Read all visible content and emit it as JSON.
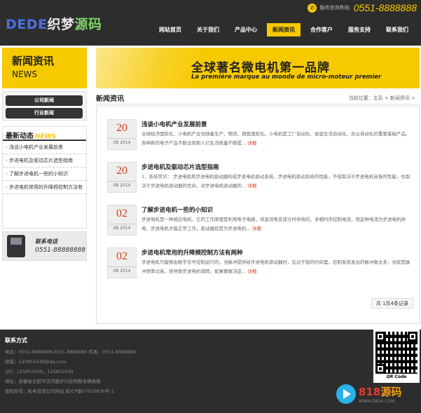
{
  "header": {
    "logo": {
      "part1": "DEDE",
      "part2": "织梦",
      "part3": "源码"
    },
    "hotline_label": "服务咨询热线:",
    "hotline_number": "0551-8888888",
    "nav": [
      {
        "label": "网站首页"
      },
      {
        "label": "关于我们"
      },
      {
        "label": "产品中心"
      },
      {
        "label": "新闻资讯",
        "active": true
      },
      {
        "label": "合作客户"
      },
      {
        "label": "服务支持"
      },
      {
        "label": "联系我们"
      }
    ]
  },
  "sidebar": {
    "title_cn": "新闻资讯",
    "title_en": "NEWS",
    "menu": [
      {
        "label": "公司新闻"
      },
      {
        "label": "行业新闻"
      }
    ],
    "latest_title_cn": "最新动态",
    "latest_title_en": "NEWS",
    "latest_items": [
      {
        "label": "浅谈小电机产业发展前景"
      },
      {
        "label": "步进电机及驱动芯片选型指南"
      },
      {
        "label": "了解步进电机一些的小知识"
      },
      {
        "label": "步进电机常用的升降频控制方法有"
      }
    ],
    "contact_label": "联系电话",
    "contact_number": "0551-88888888"
  },
  "banner": {
    "main": "全球著名微电机第一品牌",
    "sub": "La première marque au monde de micro-moteur premier"
  },
  "content": {
    "title": "新闻资讯",
    "breadcrumb": "当前位置：主页 > 新闻资讯 >",
    "news": [
      {
        "day": "20",
        "ym": "08 2014",
        "title": "浅谈小电机产业发展前景",
        "desc": "全球经济国际化，小电机产业也随着生产、物流、销售国际化。小电机是工厂自动化、家庭生活自动化、办公自动化的重要基础产品。各种新的电子产品不断出现和人们生活质量不断提...",
        "more": "详细"
      },
      {
        "day": "20",
        "ym": "08 2014",
        "title": "步进电机及驱动芯片选型指南",
        "desc": "1、系统常识： 步进电机和步进电机驱动器构成步进电机驱动系统。步进电机驱动系统的性能，不但取决于步进电机自身的性能，也取决于步进电机驱动器的优劣。对步进电机驱动器的...",
        "more": "详细"
      },
      {
        "day": "02",
        "ym": "08 2014",
        "title": "了解步进电机一些的小知识",
        "desc": "步进电机是一种感应电机，它的工作原理是利用电子电路，将直流电变成分时供电的，多相时序控制电流，用这种电流为步进电机供电，步进电机才能正常工作，驱动器就是为步进电机...",
        "more": "详细"
      },
      {
        "day": "02",
        "ym": "08 2014",
        "title": "步进电机常用的升降频控制方法有两种",
        "desc": "步进电机只能够由数字信号控制运行的，当脉冲提供给步进电机驱动器时，在过于短的时间里，控制系统发出的脉冲数太多，也就是脉冲频率过高，将导致步进电机堵转。如果要解决这...",
        "more": "详细"
      }
    ],
    "pager": "共 1页4条记录"
  },
  "footer": {
    "title": "联系方式",
    "lines": [
      "电话：0551-8888888,0551-8888888 传真：0551-8888888",
      "邮箱：125852439@qq.com",
      "QQ：125852439，125852439",
      "地址：安徽省合肥市滨河路步行街明教寺横路阁",
      "版权所有：机电有限公司网站 皖ICP备07010836号-1"
    ],
    "qr_label": "QR Code"
  },
  "watermark": {
    "num": "818",
    "text": "源码",
    "url": "WWW.Q818.COM"
  }
}
